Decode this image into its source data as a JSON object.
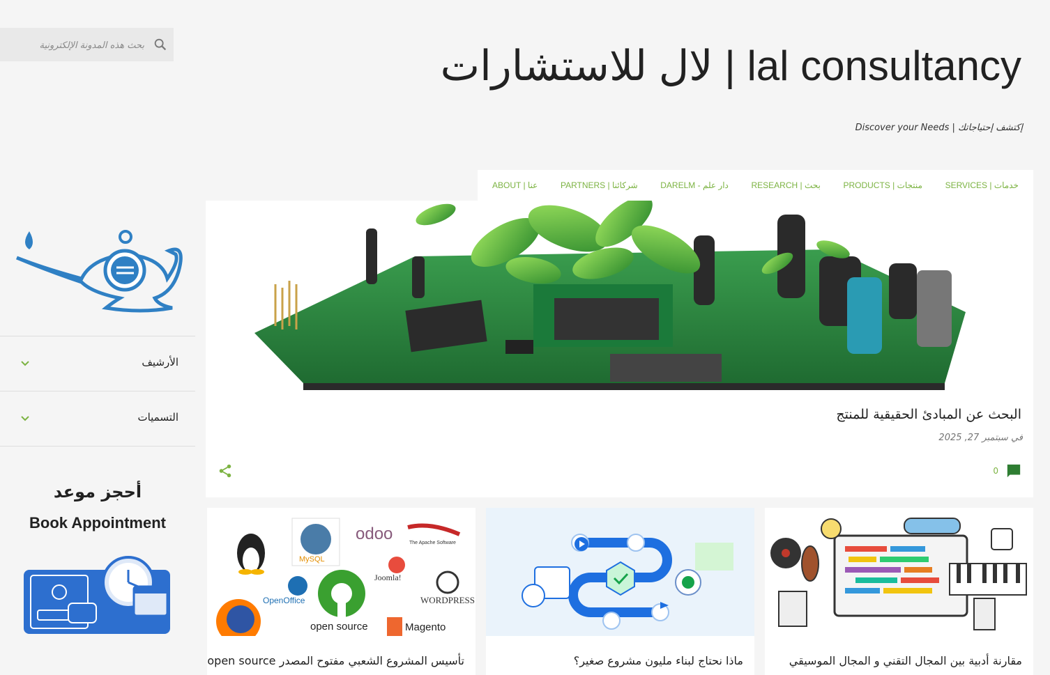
{
  "search": {
    "placeholder": "بحث هذه المدونة الإلكترونية",
    "icon": "search-icon"
  },
  "header": {
    "title": "lal consultancy | لال للاستشارات",
    "description": "Discover your Needs | إكتشف إحتياجاتك"
  },
  "nav": {
    "items": [
      {
        "label": "SERVICES | خدمات"
      },
      {
        "label": "PRODUCTS | منتجات"
      },
      {
        "label": "RESEARCH | بحث"
      },
      {
        "label": "DARELM - دار علم"
      },
      {
        "label": "PARTNERS | شركائنا"
      },
      {
        "label": "ABOUT | عنا"
      }
    ]
  },
  "featured": {
    "image": "circuit-board-with-plants",
    "title": "البحث عن المبادئ الحقيقية للمنتج",
    "date": "في سبتمبر 27, 2025",
    "comments": "0"
  },
  "cards": [
    {
      "title": "مقارنة أدبية بين المجال التقني و المجال الموسيقي",
      "image": "music-and-tech-illustration"
    },
    {
      "title": "ماذا نحتاج لبناء مليون مشروع صغير؟",
      "image": "project-roadmap-illustration"
    },
    {
      "title": "تأسيس المشروع الشعبي مفتوح المصدر open source",
      "image": "open-source-logos-collage"
    }
  ],
  "sidebar": {
    "archive_label": "الأرشيف",
    "labels_label": "التسميات",
    "book_ar": "أحجز موعد",
    "book_en": "Book Appointment"
  },
  "colors": {
    "accent": "#7cb342",
    "logo": "#2f80c4",
    "appointment": "#2d6fcf"
  }
}
